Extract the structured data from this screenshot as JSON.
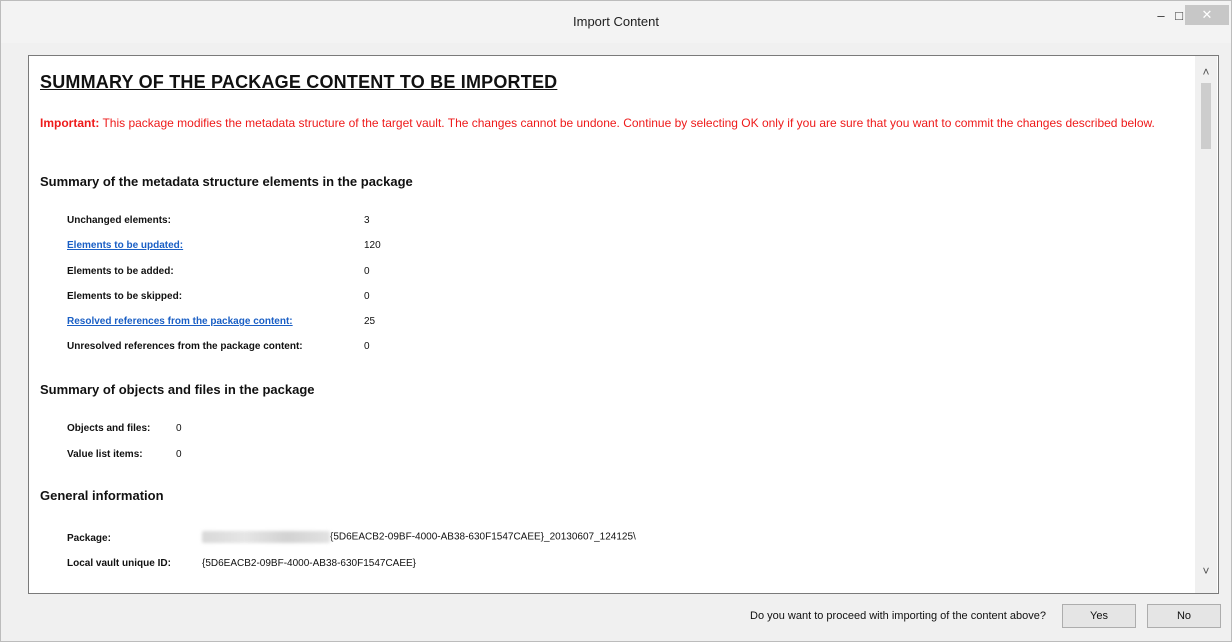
{
  "window": {
    "title": "Import Content",
    "minimize_glyph": "–",
    "maximize_glyph": "□",
    "close_glyph": "✕"
  },
  "content": {
    "heading": "SUMMARY OF THE PACKAGE CONTENT TO BE IMPORTED",
    "important_label": "Important:",
    "important_text": " This package modifies the metadata structure of the target vault. The changes cannot be undone. Continue by selecting OK only if you are sure that you want to commit the changes described below.",
    "metadata_section": {
      "title": "Summary of the metadata structure elements in the package",
      "rows": [
        {
          "label": "Unchanged elements:",
          "value": "3",
          "link": false
        },
        {
          "label": "Elements to be updated:",
          "value": "120",
          "link": true
        },
        {
          "label": "Elements to be added:",
          "value": "0",
          "link": false
        },
        {
          "label": "Elements to be skipped:",
          "value": "0",
          "link": false
        },
        {
          "label": "Resolved references from the package content:",
          "value": "25",
          "link": true
        },
        {
          "label": "Unresolved references from the package content:",
          "value": "0",
          "link": false
        }
      ]
    },
    "objects_section": {
      "title": "Summary of objects and files in the package",
      "rows": [
        {
          "label": "Objects and files:",
          "value": "0"
        },
        {
          "label": "Value list items:",
          "value": "0"
        }
      ]
    },
    "general_section": {
      "title": "General information",
      "rows": [
        {
          "label": "Package:",
          "value": "{5D6EACB2-09BF-4000-AB38-630F1547CAEE}_20130607_124125\\"
        },
        {
          "label": "Local vault unique ID:",
          "value": "{5D6EACB2-09BF-4000-AB38-630F1547CAEE}"
        }
      ]
    }
  },
  "footer": {
    "question": "Do you want to proceed with importing of the content above?",
    "yes_label": "Yes",
    "no_label": "No"
  },
  "scrollbar": {
    "up_glyph": "˄",
    "down_glyph": "˅"
  }
}
